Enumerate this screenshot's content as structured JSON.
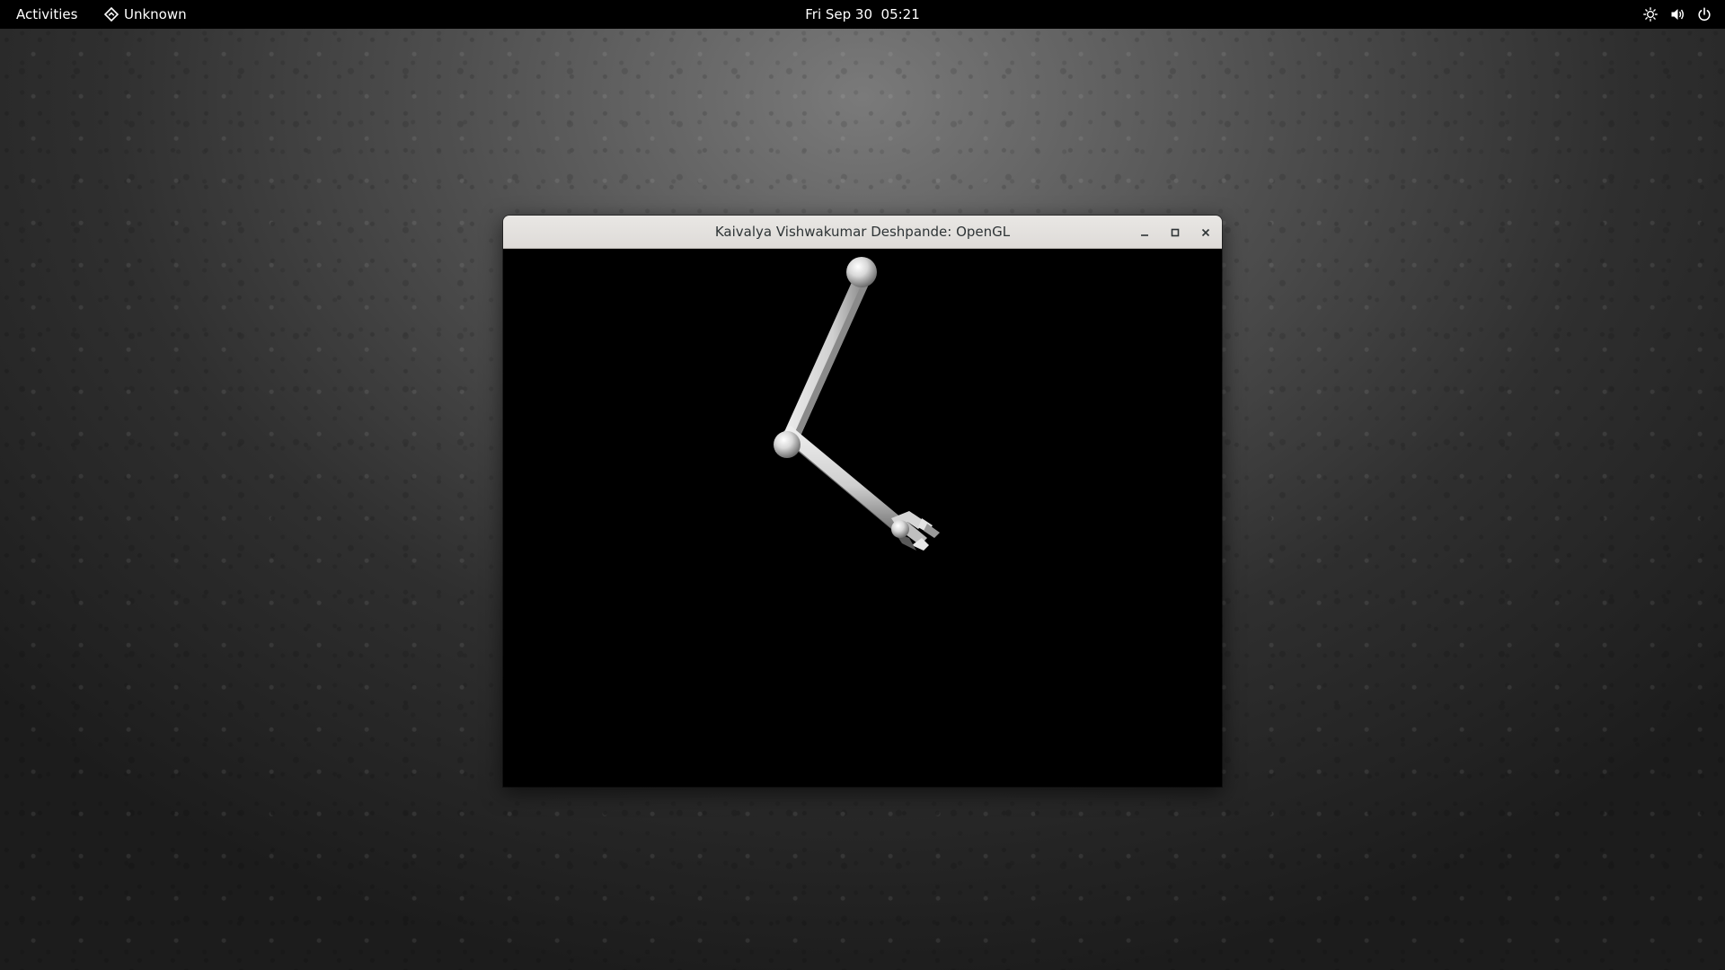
{
  "topbar": {
    "activities_label": "Activities",
    "app_name": "Unknown",
    "clock": "Fri Sep 30  05:21",
    "icons": [
      "brightness-icon",
      "volume-icon",
      "power-icon"
    ]
  },
  "window": {
    "title": "Kaivalya Vishwakumar Deshpande: OpenGL",
    "controls": [
      "minimize-icon",
      "maximize-icon",
      "close-icon"
    ],
    "canvas_background": "#000000",
    "arm_color": "#e6e6e6"
  },
  "desktop": {
    "background_center": "#7a7a7a",
    "background_edge": "#1c1c1c"
  }
}
